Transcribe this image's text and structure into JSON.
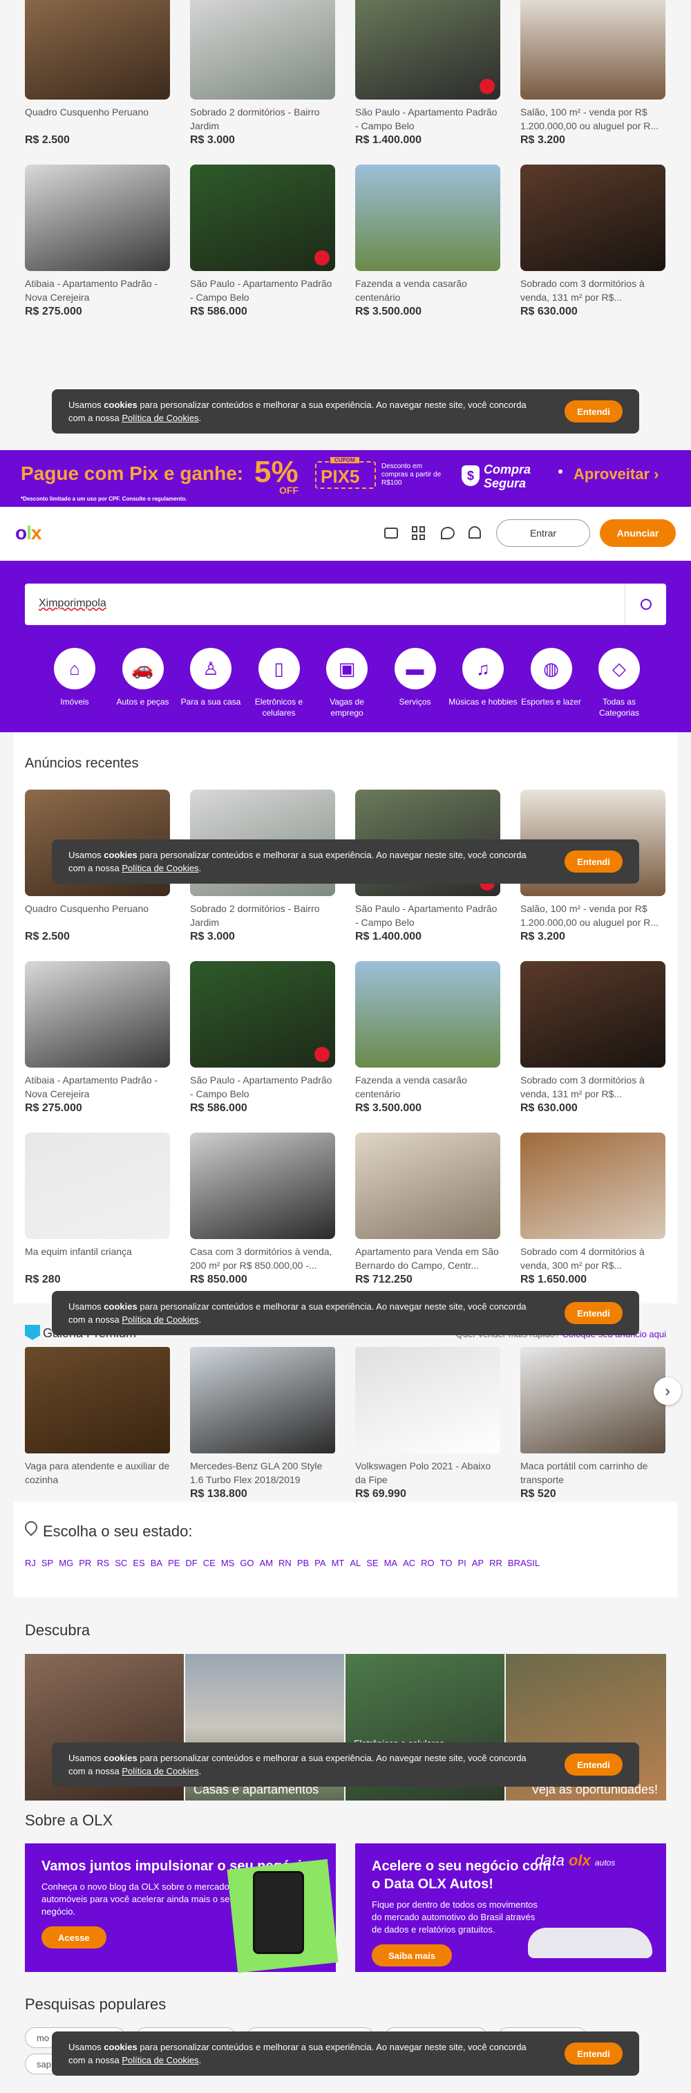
{
  "listings_top": [
    {
      "title": "Quadro Cusquenho Peruano",
      "price": "R$ 2.500"
    },
    {
      "title": "Sobrado 2 dormitórios - Bairro Jardim",
      "price": "R$ 3.000"
    },
    {
      "title": "São Paulo - Apartamento Padrão - Campo Belo",
      "price": "R$ 1.400.000"
    },
    {
      "title": "Salão, 100 m² - venda por R$ 1.200.000,00 ou aluguel por R...",
      "price": "R$ 3.200"
    },
    {
      "title": "Atibaia - Apartamento Padrão - Nova Cerejeira",
      "price": "R$ 275.000"
    },
    {
      "title": "São Paulo - Apartamento Padrão - Campo Belo",
      "price": "R$ 586.000"
    },
    {
      "title": "Fazenda a venda casarão centenário",
      "price": "R$ 3.500.000"
    },
    {
      "title": "Sobrado com 3 dormitórios à venda, 131 m² por R$...",
      "price": "R$ 630.000"
    }
  ],
  "cookie": {
    "text_pre": "Usamos ",
    "text_bold": "cookies",
    "text_mid": " para personalizar conteúdos e melhorar a sua experiência. Ao navegar neste site, você concorda com a nossa ",
    "text_link": "Política de Cookies",
    "text_end": ".",
    "button": "Entendi"
  },
  "promo": {
    "headline": "Pague com Pix e ganhe:",
    "percent": "5%",
    "off": "OFF",
    "cupom_label": "CUPOM",
    "cupom": "PIX5",
    "desc": "Desconto em compras a partir de R$100",
    "brand1": "Compra",
    "brand2": "Segura",
    "cta": "Aproveitar",
    "disclaimer": "*Desconto limitado a um uso por CPF. Consulte o regulamento."
  },
  "header": {
    "logo": "olx",
    "login": "Entrar",
    "announce": "Anunciar"
  },
  "search": {
    "value": "Ximporimpola"
  },
  "categories": [
    {
      "label": "Imóveis",
      "icon": "house-icon"
    },
    {
      "label": "Autos e peças",
      "icon": "car-icon"
    },
    {
      "label": "Para a sua casa",
      "icon": "lamp-icon"
    },
    {
      "label": "Eletrônicos e celulares",
      "icon": "phone-icon"
    },
    {
      "label": "Vagas de emprego",
      "icon": "badge-icon"
    },
    {
      "label": "Serviços",
      "icon": "paint-roller-icon"
    },
    {
      "label": "Músicas e hobbies",
      "icon": "music-icon"
    },
    {
      "label": "Esportes e lazer",
      "icon": "ball-icon"
    },
    {
      "label": "Todas as Categorias",
      "icon": "shapes-icon"
    }
  ],
  "recent": {
    "title": "Anúncios recentes",
    "items": [
      {
        "title": "Quadro Cusquenho Peruano",
        "price": "R$ 2.500"
      },
      {
        "title": "Sobrado 2 dormitórios - Bairro Jardim",
        "price": "R$ 3.000"
      },
      {
        "title": "São Paulo - Apartamento Padrão - Campo Belo",
        "price": "R$ 1.400.000"
      },
      {
        "title": "Salão, 100 m² - venda por R$ 1.200.000,00 ou aluguel por R...",
        "price": "R$ 3.200"
      },
      {
        "title": "Atibaia - Apartamento Padrão - Nova Cerejeira",
        "price": "R$ 275.000"
      },
      {
        "title": "São Paulo - Apartamento Padrão - Campo Belo",
        "price": "R$ 586.000"
      },
      {
        "title": "Fazenda a venda casarão centenário",
        "price": "R$ 3.500.000"
      },
      {
        "title": "Sobrado com 3 dormitórios à venda, 131 m² por R$...",
        "price": "R$ 630.000"
      },
      {
        "title": "Ma equim infantil criança",
        "price": "R$ 280"
      },
      {
        "title": "Casa com 3 dormitórios à venda, 200 m² por R$ 850.000,00 -...",
        "price": "R$ 850.000"
      },
      {
        "title": "Apartamento para Venda em São Bernardo do Campo, Centr...",
        "price": "R$ 712.250"
      },
      {
        "title": "Sobrado com 4 dormitórios à venda, 300 m² por R$...",
        "price": "R$ 1.650.000"
      }
    ]
  },
  "premium": {
    "title": "Galeria Premium",
    "cta_pre": "Quer vender mais rápido? ",
    "cta_link": "Coloque seu anúncio aqui",
    "items": [
      {
        "title": "Vaga para atendente e auxiliar de cozinha",
        "price": ""
      },
      {
        "title": "Mercedes-Benz GLA 200 Style 1.6 Turbo Flex 2018/2019",
        "price": "R$ 138.800"
      },
      {
        "title": "Volkswagen Polo 2021 - Abaixo da Fipe",
        "price": "R$ 69.990"
      },
      {
        "title": "Maca portátil com carrinho de transporte",
        "price": "R$ 520"
      }
    ]
  },
  "states": {
    "title": "Escolha o seu estado:",
    "list": [
      "RJ",
      "SP",
      "MG",
      "PR",
      "RS",
      "SC",
      "ES",
      "BA",
      "PE",
      "DF",
      "CE",
      "MS",
      "GO",
      "AM",
      "RN",
      "PB",
      "PA",
      "MT",
      "AL",
      "SE",
      "MA",
      "AC",
      "RO",
      "TO",
      "PI",
      "AP",
      "RR",
      "BRASIL"
    ]
  },
  "discover": {
    "title": "Descubra",
    "tiles": [
      {
        "label": ""
      },
      {
        "label": "Casas e apartamentos"
      },
      {
        "label": "Eletrônicos e celulares"
      },
      {
        "label": "Veja as oportunidades!"
      }
    ]
  },
  "about": {
    "title": "Sobre a OLX",
    "blog": {
      "title": "Vamos juntos impulsionar o seu negócio?",
      "text": "Conheça o novo blog da OLX sobre o mercado de automóveis para você acelerar ainda mais o seu negócio.",
      "button": "Acesse"
    },
    "data": {
      "title": "Acelere o seu negócio com o Data OLX Autos!",
      "text": "Fique por dentro de todos os movimentos do mercado automotivo do Brasil através de dados e relatórios gratuitos.",
      "button": "Saiba mais",
      "brand": "data",
      "brand_sub": "autos"
    }
  },
  "popular": {
    "title": "Pesquisas populares",
    "chips": [
      "mo",
      "",
      "",
      "",
      "",
      "sap"
    ]
  },
  "colors": {
    "purple": "#6e0ad6",
    "orange": "#f28000",
    "dark": "#3d3d3d"
  }
}
